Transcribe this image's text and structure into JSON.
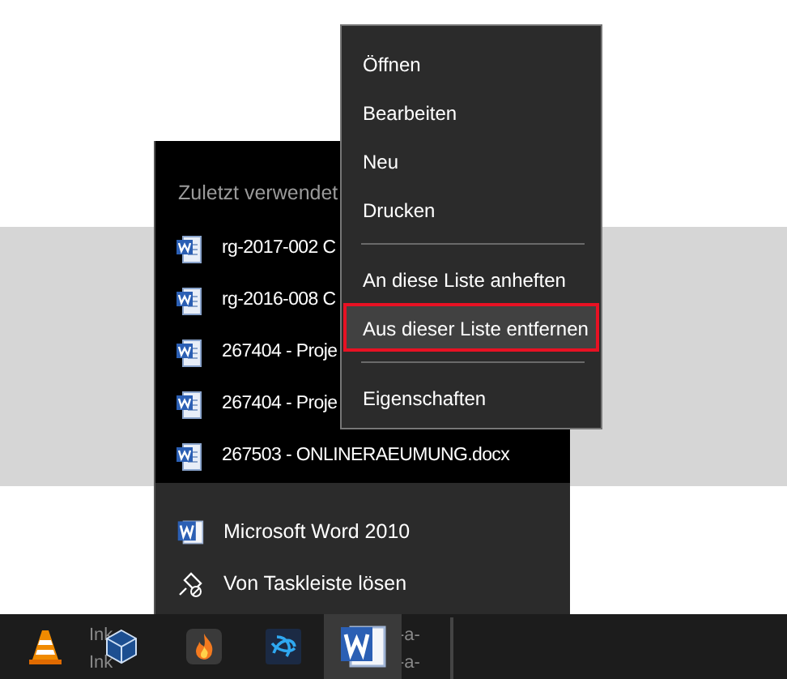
{
  "jump_list": {
    "heading": "Zuletzt verwendet",
    "recent": [
      {
        "label": "rg-2017-002 C"
      },
      {
        "label": "rg-2016-008 C"
      },
      {
        "label": "267404 - Proje"
      },
      {
        "label": "267404 - Proje"
      },
      {
        "label": "267503 - ONLINERAEUMUNG.docx"
      }
    ],
    "tasks": [
      {
        "kind": "app",
        "label": "Microsoft Word 2010"
      },
      {
        "kind": "unpin",
        "label": "Von Taskleiste lösen"
      }
    ]
  },
  "context_menu": {
    "items": [
      {
        "kind": "item",
        "label": "Öffnen",
        "selected": false
      },
      {
        "kind": "item",
        "label": "Bearbeiten",
        "selected": false
      },
      {
        "kind": "item",
        "label": "Neu",
        "selected": false
      },
      {
        "kind": "item",
        "label": "Drucken",
        "selected": false
      },
      {
        "kind": "separator"
      },
      {
        "kind": "item",
        "label": "An diese Liste anheften",
        "selected": false
      },
      {
        "kind": "item",
        "label": "Aus dieser Liste entfernen",
        "selected": true
      },
      {
        "kind": "separator"
      },
      {
        "kind": "item",
        "label": "Eigenschaften",
        "selected": false
      }
    ]
  },
  "taskbar": {
    "background_texts": [
      "Ink",
      "Ink",
      "-a-",
      "-a-"
    ],
    "apps": [
      {
        "kind": "vlc",
        "active": false
      },
      {
        "kind": "virtualbox",
        "active": false
      },
      {
        "kind": "burner",
        "active": false
      },
      {
        "kind": "blue-logo",
        "active": false
      },
      {
        "kind": "word",
        "active": true
      }
    ]
  }
}
